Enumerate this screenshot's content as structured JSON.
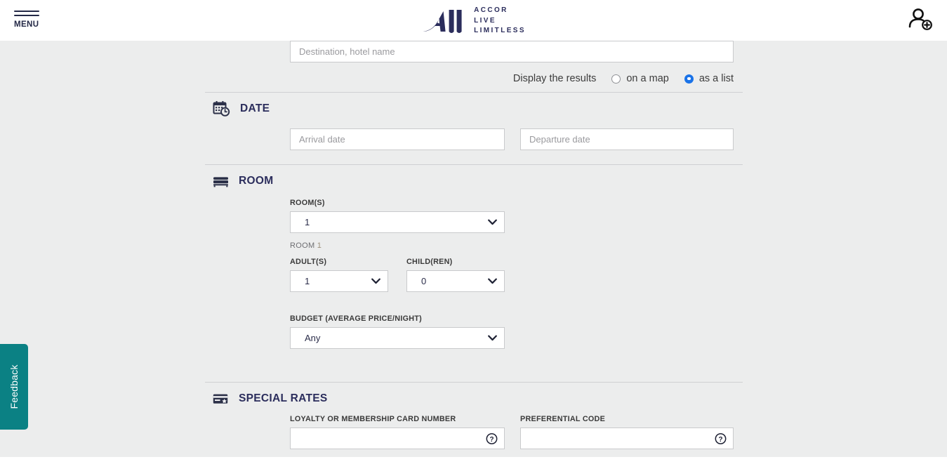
{
  "header": {
    "menu_label": "MENU",
    "logo_mark_text": "All",
    "logo_lines": [
      "ACCOR",
      "LIVE",
      "LIMITLESS"
    ],
    "menu_icon": "hamburger-icon",
    "account_icon": "add-user-icon"
  },
  "search": {
    "destination_placeholder": "Destination, hotel name",
    "destination_value": "",
    "display_results_label": "Display the results",
    "options": [
      {
        "label": "on a map",
        "selected": false
      },
      {
        "label": "as a list",
        "selected": true
      }
    ],
    "selected_color": "#1a73e8"
  },
  "date_section": {
    "title": "DATE",
    "icon": "calendar-clock-icon",
    "arrival": {
      "placeholder": "Arrival date",
      "value": "",
      "icon": "calendar-icon"
    },
    "departure": {
      "placeholder": "Departure date",
      "value": "",
      "icon": "calendar-icon"
    }
  },
  "room_section": {
    "title": "ROOM",
    "icon": "bed-icon",
    "rooms_label": "ROOM(S)",
    "rooms_value": "1",
    "room_sub_label": "ROOM",
    "room_sub_number": "1",
    "adults_label": "ADULT(S)",
    "adults_value": "1",
    "children_label": "CHILD(REN)",
    "children_value": "0",
    "budget_label": "BUDGET (AVERAGE PRICE/NIGHT)",
    "budget_value": "Any"
  },
  "special_rates": {
    "title": "SPECIAL RATES",
    "icon": "card-star-icon",
    "loyalty_label": "LOYALTY OR MEMBERSHIP CARD NUMBER",
    "loyalty_value": "",
    "loyalty_help_icon": "help-circle-icon",
    "preferential_label": "PREFERENTIAL CODE",
    "preferential_value": "",
    "preferential_help_icon": "help-circle-icon"
  },
  "feedback": {
    "label": "Feedback",
    "color": "#0b8184"
  }
}
